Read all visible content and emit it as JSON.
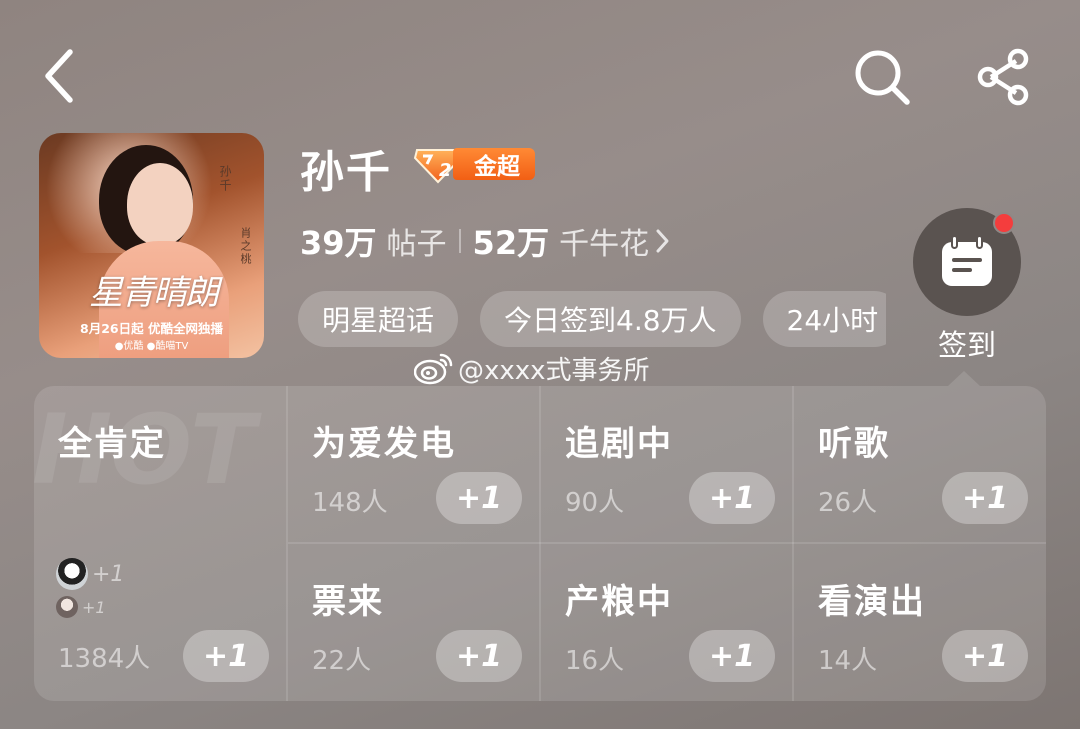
{
  "header": {
    "back_icon": "chevron-left-icon",
    "search_icon": "search-icon",
    "share_icon": "share-icon"
  },
  "cover": {
    "side_name": "孙千",
    "side_role": "肖之桃",
    "script_title": "星青晴朗",
    "date_line": "8月26日起 优酷全网独播",
    "platforms": "●优酷  ●酷喵TV"
  },
  "profile": {
    "name": "孙千",
    "level_number": "2",
    "level_tier": "金超",
    "posts_count": "39万",
    "posts_label": "帖子",
    "flowers_count": "52万",
    "flowers_label": "千牛花"
  },
  "chips": [
    "明星超话",
    "今日签到4.8万人",
    "24小时"
  ],
  "checkin": {
    "label": "签到",
    "icon": "calendar-icon"
  },
  "watermark": {
    "text": "@xxxx式事务所",
    "icon": "weibo-logo"
  },
  "grid": {
    "featured": {
      "bg_text": "HOT",
      "title": "全肯定",
      "avatar_plus_1": "+1",
      "avatar_plus_2": "+1",
      "count": "1384人",
      "button": "+1"
    },
    "cells": [
      {
        "title": "为爱发电",
        "count": "148人",
        "button": "+1"
      },
      {
        "title": "追剧中",
        "count": "90人",
        "button": "+1"
      },
      {
        "title": "听歌",
        "count": "26人",
        "button": "+1"
      },
      {
        "title": "票来",
        "count": "22人",
        "button": "+1"
      },
      {
        "title": "产粮中",
        "count": "16人",
        "button": "+1"
      },
      {
        "title": "看演出",
        "count": "14人",
        "button": "+1"
      }
    ]
  },
  "colors": {
    "badge_orange": "#f25f14",
    "notification_red": "#f43d3d"
  }
}
